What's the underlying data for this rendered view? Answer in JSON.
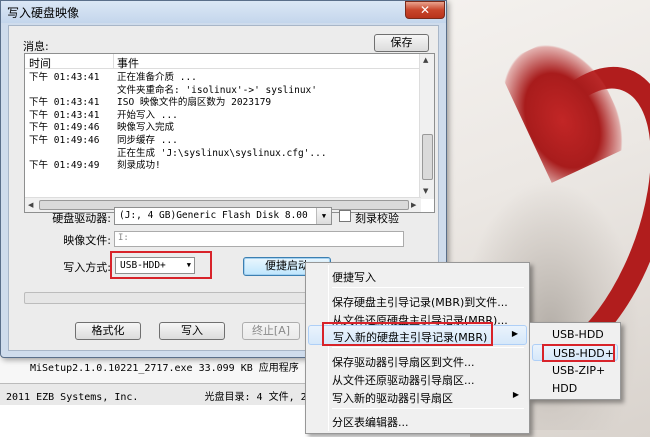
{
  "window": {
    "title": "写入硬盘映像",
    "close_glyph": "✕"
  },
  "messages": {
    "label": "消息:",
    "save_button": "保存",
    "columns": [
      "时间",
      "事件"
    ],
    "rows": [
      {
        "time": "下午 01:43:41",
        "event": "正在准备介质 ..."
      },
      {
        "time": "",
        "event": "文件夹重命名: 'isolinux'->' syslinux'"
      },
      {
        "time": "下午 01:43:41",
        "event": "ISO 映像文件的扇区数为 2023179"
      },
      {
        "time": "下午 01:43:41",
        "event": "开始写入 ..."
      },
      {
        "time": "下午 01:49:46",
        "event": "映像写入完成"
      },
      {
        "time": "下午 01:49:46",
        "event": "同步缓存 ..."
      },
      {
        "time": "",
        "event": "正在生成 'J:\\syslinux\\syslinux.cfg'..."
      },
      {
        "time": "下午 01:49:49",
        "event": "刻录成功!"
      }
    ]
  },
  "form": {
    "drive_label": "硬盘驱动器:",
    "drive_value": "(J:, 4 GB)Generic Flash Disk       8.00",
    "verify_label": "刻录校验",
    "image_label": "映像文件:",
    "image_value": "I:",
    "mode_label": "写入方式:",
    "mode_value": "USB-HDD+",
    "boot_button": "便捷启动"
  },
  "buttons": {
    "format": "格式化",
    "write": "写入",
    "abort": "终止[A]"
  },
  "explorer": {
    "row": "MiSetup2.1.0.10221_2717.exe        33.099 KB  应用程序",
    "status_left": "2011 EZB Systems, Inc.",
    "status_right": "光盘目录: 4 文件, 2518 KB"
  },
  "context_menu": {
    "items": [
      "便捷写入",
      "保存硬盘主引导记录(MBR)到文件...",
      "从文件还原硬盘主引导记录(MBR)...",
      "写入新的硬盘主引导记录(MBR)",
      "保存驱动器引导扇区到文件...",
      "从文件还原驱动器引导扇区...",
      "写入新的驱动器引导扇区",
      "分区表编辑器..."
    ]
  },
  "submenu": {
    "items": [
      "USB-HDD",
      "USB-HDD+",
      "USB-ZIP+",
      "HDD"
    ]
  },
  "colors": {
    "highlight_box": "#d8232a",
    "accent": "#3c7fb1"
  }
}
